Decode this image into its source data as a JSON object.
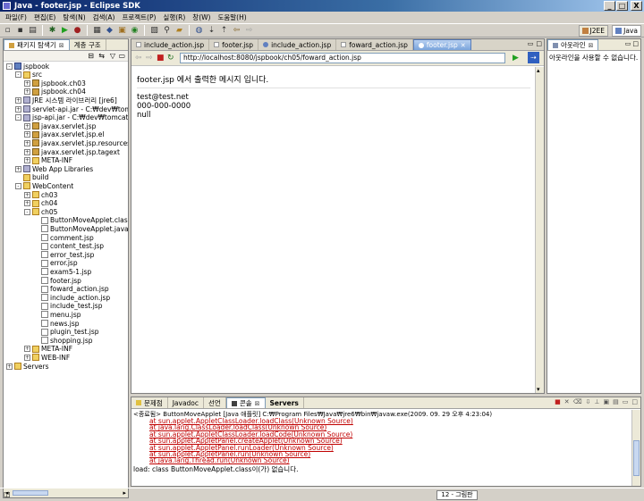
{
  "window": {
    "title": "Java - footer.jsp - Eclipse SDK",
    "min": "_",
    "max": "□",
    "close": "X"
  },
  "menu": [
    "파일(F)",
    "편집(E)",
    "탐색(N)",
    "검색(A)",
    "프로젝트(P)",
    "실행(R)",
    "창(W)",
    "도움말(H)"
  ],
  "perspectives": {
    "j2ee": "J2EE",
    "java": "Java"
  },
  "left_panel": {
    "tabs": [
      {
        "label": "패키지 탐색기"
      },
      {
        "label": "계층 구조"
      }
    ],
    "tree": [
      {
        "level": 0,
        "toggle": "-",
        "icon": "proj",
        "label": "jspbook"
      },
      {
        "level": 1,
        "toggle": "-",
        "icon": "folder",
        "label": "src"
      },
      {
        "level": 2,
        "toggle": "+",
        "icon": "pkg",
        "label": "jspbook.ch03"
      },
      {
        "level": 2,
        "toggle": "+",
        "icon": "pkg",
        "label": "jspbook.ch04"
      },
      {
        "level": 1,
        "toggle": "+",
        "icon": "jar",
        "label": "JRE 시스템 라이브러리 [jre6]"
      },
      {
        "level": 1,
        "toggle": "+",
        "icon": "jar",
        "label": "servlet-api.jar - C:₩dev₩tomca"
      },
      {
        "level": 1,
        "toggle": "-",
        "icon": "jar",
        "label": "jsp-api.jar - C:₩dev₩tomcat5₩"
      },
      {
        "level": 2,
        "toggle": "+",
        "icon": "pkg",
        "label": "javax.servlet.jsp"
      },
      {
        "level": 2,
        "toggle": "+",
        "icon": "pkg",
        "label": "javax.servlet.jsp.el"
      },
      {
        "level": 2,
        "toggle": "+",
        "icon": "pkg",
        "label": "javax.servlet.jsp.resources"
      },
      {
        "level": 2,
        "toggle": "+",
        "icon": "pkg",
        "label": "javax.servlet.jsp.tagext"
      },
      {
        "level": 2,
        "toggle": "+",
        "icon": "folder",
        "label": "META-INF"
      },
      {
        "level": 1,
        "toggle": "+",
        "icon": "jar",
        "label": "Web App Libraries"
      },
      {
        "level": 1,
        "toggle": "",
        "icon": "folder",
        "label": "build"
      },
      {
        "level": 1,
        "toggle": "-",
        "icon": "folder",
        "label": "WebContent"
      },
      {
        "level": 2,
        "toggle": "+",
        "icon": "folder",
        "label": "ch03"
      },
      {
        "level": 2,
        "toggle": "+",
        "icon": "folder",
        "label": "ch04"
      },
      {
        "level": 2,
        "toggle": "-",
        "icon": "folder",
        "label": "ch05"
      },
      {
        "level": 3,
        "toggle": "",
        "icon": "file",
        "label": "ButtonMoveApplet.class"
      },
      {
        "level": 3,
        "toggle": "",
        "icon": "file",
        "label": "ButtonMoveApplet.java"
      },
      {
        "level": 3,
        "toggle": "",
        "icon": "file",
        "label": "comment.jsp"
      },
      {
        "level": 3,
        "toggle": "",
        "icon": "file",
        "label": "content_test.jsp"
      },
      {
        "level": 3,
        "toggle": "",
        "icon": "file",
        "label": "error_test.jsp"
      },
      {
        "level": 3,
        "toggle": "",
        "icon": "file",
        "label": "error.jsp"
      },
      {
        "level": 3,
        "toggle": "",
        "icon": "file",
        "label": "exam5-1.jsp"
      },
      {
        "level": 3,
        "toggle": "",
        "icon": "file",
        "label": "footer.jsp"
      },
      {
        "level": 3,
        "toggle": "",
        "icon": "file",
        "label": "foward_action.jsp"
      },
      {
        "level": 3,
        "toggle": "",
        "icon": "file",
        "label": "include_action.jsp"
      },
      {
        "level": 3,
        "toggle": "",
        "icon": "file",
        "label": "include_test.jsp"
      },
      {
        "level": 3,
        "toggle": "",
        "icon": "file",
        "label": "menu.jsp"
      },
      {
        "level": 3,
        "toggle": "",
        "icon": "file",
        "label": "news.jsp"
      },
      {
        "level": 3,
        "toggle": "",
        "icon": "file",
        "label": "plugin_test.jsp"
      },
      {
        "level": 3,
        "toggle": "",
        "icon": "file",
        "label": "shopping.jsp"
      },
      {
        "level": 2,
        "toggle": "+",
        "icon": "folder",
        "label": "META-INF"
      },
      {
        "level": 2,
        "toggle": "+",
        "icon": "folder",
        "label": "WEB-INF"
      },
      {
        "level": 0,
        "toggle": "+",
        "icon": "folder",
        "label": "Servers"
      }
    ]
  },
  "editor": {
    "tabs": [
      {
        "label": "include_action.jsp"
      },
      {
        "label": "footer.jsp"
      },
      {
        "label": "include_action.jsp"
      },
      {
        "label": "foward_action.jsp"
      },
      {
        "label": "footer.jsp",
        "active": true
      }
    ],
    "url": "http://localhost:8080/jspbook/ch05/foward_action.jsp",
    "content": {
      "heading": "footer.jsp 에서 출력한 메시지 입니다.",
      "lines": [
        "test@test.net",
        "000-000-0000",
        "null"
      ]
    }
  },
  "outline": {
    "tab": "아웃라인",
    "message": "아웃라인을 사용할 수 없습니다."
  },
  "console": {
    "tabs": [
      {
        "label": "문제점"
      },
      {
        "label": "Javadoc"
      },
      {
        "label": "선언"
      },
      {
        "label": "콘솔",
        "active": true
      },
      {
        "label": "Servers"
      }
    ],
    "header": "<종료됨> ButtonMoveApplet [Java 애플릿] C:₩Program Files₩Java₩jre6₩bin₩javaw.exe(2009. 09. 29 오후 4:23:04)",
    "lines": [
      "at sun.applet.AppletClassLoader.loadClass(Unknown Source)",
      "at java.lang.ClassLoader.loadClass(Unknown Source)",
      "at sun.applet.AppletClassLoader.loadCode(Unknown Source)",
      "at sun.applet.AppletPanel.createApplet(Unknown Source)",
      "at sun.applet.AppletPanel.runLoader(Unknown Source)",
      "at sun.applet.AppletPanel.run(Unknown Source)",
      "at java.lang.Thread.run(Unknown Source)"
    ],
    "last_line": "load: class ButtonMoveApplet.class이(가) 없습니다."
  },
  "status": {
    "memory": "12 - 그림판"
  }
}
